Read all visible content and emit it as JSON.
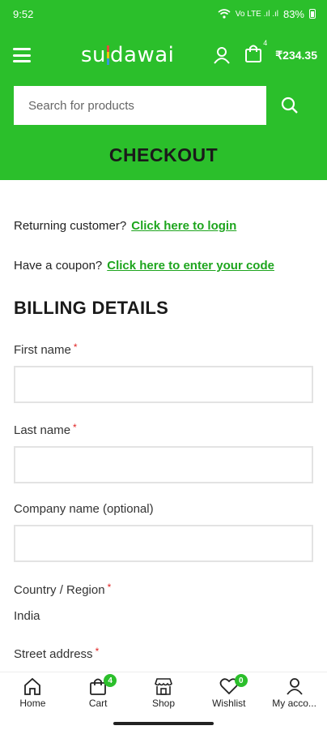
{
  "status_bar": {
    "time": "9:52",
    "network": "Vo LTE .ıl .ıl",
    "battery": "83%"
  },
  "header": {
    "logo": {
      "left": "su",
      "right": "dawai"
    },
    "cart_count": "4",
    "cart_total": "₹234.35",
    "search": {
      "placeholder": "Search for products"
    },
    "page_title": "CHECKOUT"
  },
  "notices": {
    "returning_text": "Returning customer?",
    "login_link": "Click here to login",
    "coupon_text": "Have a coupon?",
    "coupon_link": "Click here to enter your code"
  },
  "billing": {
    "title": "BILLING DETAILS",
    "first_name_label": "First name",
    "last_name_label": "Last name",
    "company_label": "Company name (optional)",
    "country_label": "Country / Region",
    "country_value": "India",
    "street_label": "Street address",
    "required_mark": "*"
  },
  "bottom_nav": {
    "home": "Home",
    "cart": "Cart",
    "cart_badge": "4",
    "shop": "Shop",
    "wishlist": "Wishlist",
    "wishlist_badge": "0",
    "account": "My acco..."
  },
  "colors": {
    "brand_green": "#2bbf2b",
    "link_green": "#1ea51e",
    "required_red": "#e02424"
  }
}
